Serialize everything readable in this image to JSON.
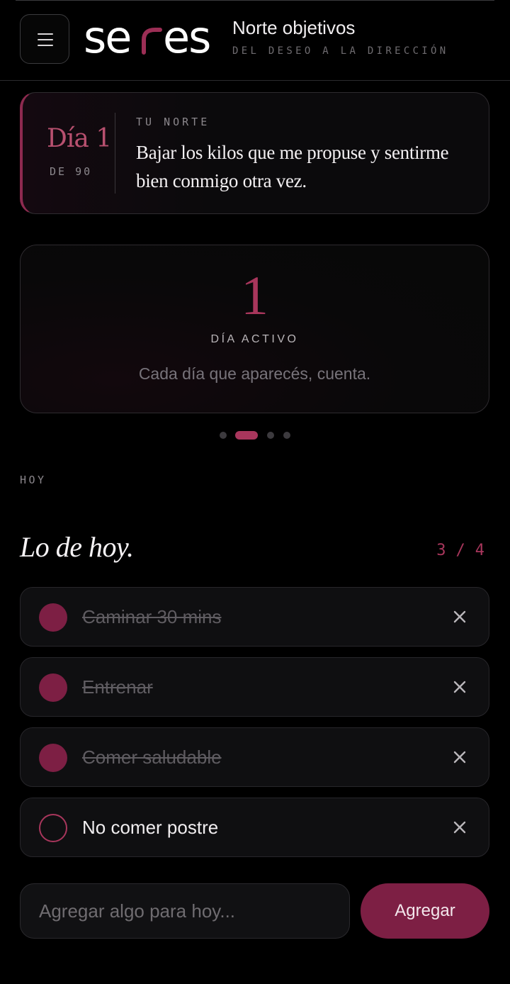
{
  "header": {
    "logo_text": "seres",
    "title": "Norte objetivos",
    "subtitle": "DEL DESEO A LA DIRECCIÓN"
  },
  "north_card": {
    "day": "Día 1",
    "of_days": "DE 90",
    "label": "TU NORTE",
    "text": "Bajar los kilos que me propuse y sentirme bien conmigo otra vez."
  },
  "active_card": {
    "number": "1",
    "label": "DÍA ACTIVO",
    "subtitle": "Cada día que aparecés, cuenta."
  },
  "carousel": {
    "total": 4,
    "active_index": 1
  },
  "today": {
    "section_label": "HOY",
    "title": "Lo de hoy.",
    "done_count": "3",
    "separator": "/",
    "total_count": "4",
    "tasks": [
      {
        "label": "Caminar 30 mins",
        "done": true
      },
      {
        "label": "Entrenar",
        "done": true
      },
      {
        "label": "Comer saludable",
        "done": true
      },
      {
        "label": "No comer postre",
        "done": false
      }
    ]
  },
  "add_form": {
    "placeholder": "Agregar algo para hoy...",
    "button_label": "Agregar"
  },
  "colors": {
    "accent": "#a8365c",
    "accent_dark": "#7d1f44",
    "background": "#000000"
  }
}
